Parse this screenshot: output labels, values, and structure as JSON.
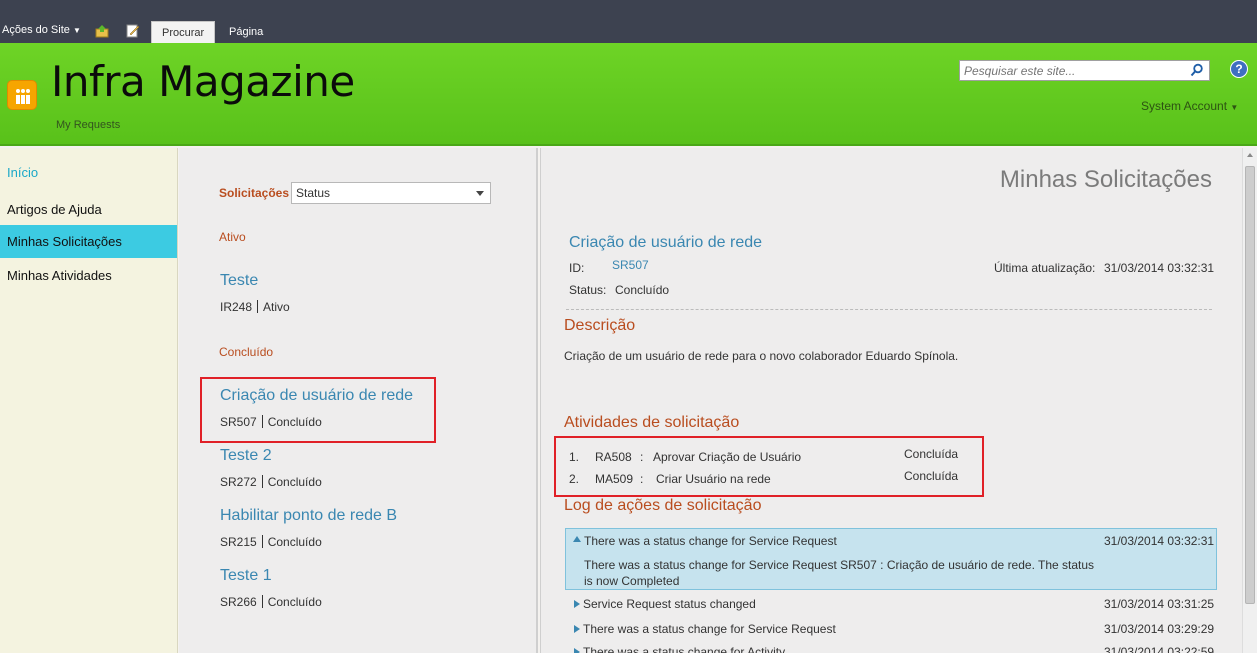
{
  "ribbon": {
    "site_actions": "Ações do Site",
    "tabs": [
      {
        "label": "Procurar"
      },
      {
        "label": "Página"
      }
    ]
  },
  "header": {
    "title": "Infra Magazine",
    "subtitle": "My Requests",
    "search_placeholder": "Pesquisar este site...",
    "account": "System Account",
    "help_label": "?"
  },
  "leftnav": {
    "items": [
      {
        "label": "Início"
      },
      {
        "label": "Artigos de Ajuda"
      },
      {
        "label": "Minhas Solicitações"
      },
      {
        "label": "Minhas Atividades"
      }
    ]
  },
  "requests": {
    "filter_label": "Solicitações",
    "filter_value": "Status",
    "groups": [
      {
        "heading": "Ativo",
        "items": [
          {
            "title": "Teste",
            "id": "IR248",
            "status": "Ativo"
          }
        ]
      },
      {
        "heading": "Concluído",
        "items": [
          {
            "title": "Criação de usuário de rede",
            "id": "SR507",
            "status": "Concluído"
          },
          {
            "title": "Teste 2",
            "id": "SR272",
            "status": "Concluído"
          },
          {
            "title": "Habilitar ponto de rede B",
            "id": "SR215",
            "status": "Concluído"
          },
          {
            "title": "Teste 1",
            "id": "SR266",
            "status": "Concluído"
          }
        ]
      }
    ]
  },
  "detail": {
    "page_title": "Minhas Solicitações",
    "title": "Criação de usuário de rede",
    "id_label": "ID:",
    "id_value": "SR507",
    "updated_label": "Última atualização:",
    "updated_value": "31/03/2014 03:32:31",
    "status_label": "Status:",
    "status_value": "Concluído",
    "description_heading": "Descrição",
    "description": "Criação de um usuário de rede para o novo colaborador Eduardo Spínola.",
    "activities_heading": "Atividades de solicitação",
    "activities": [
      {
        "num": "1.",
        "id": "RA508",
        "sep": ":",
        "name": "Aprovar Criação de Usuário",
        "status": "Concluída"
      },
      {
        "num": "2.",
        "id": "MA509",
        "sep": ":",
        "name": "Criar Usuário na rede",
        "status": "Concluída"
      }
    ],
    "log_heading": "Log de ações de solicitação",
    "log": [
      {
        "title": "There was a status change for Service Request",
        "date": "31/03/2014 03:32:31",
        "detail": "There was a status change for Service Request SR507 : Criação de usuário de rede. The status is now Completed"
      },
      {
        "title": "Service Request status changed",
        "date": "31/03/2014 03:31:25"
      },
      {
        "title": "There was a status change for Service Request",
        "date": "31/03/2014 03:29:29"
      },
      {
        "title": "There was a status change for Activity",
        "date": "31/03/2014 03:22:59"
      }
    ]
  }
}
